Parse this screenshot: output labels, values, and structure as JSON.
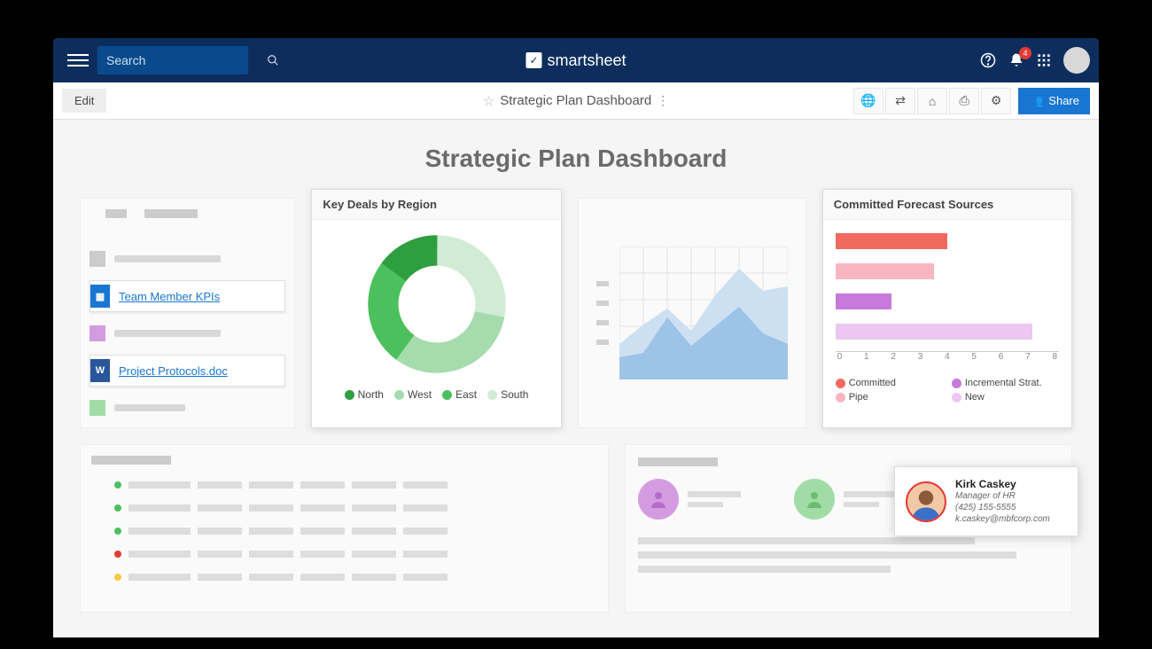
{
  "topbar": {
    "search_placeholder": "Search",
    "brand": "smartsheet",
    "notification_count": "4"
  },
  "subbar": {
    "edit_label": "Edit",
    "title": "Strategic Plan Dashboard",
    "share_label": "Share"
  },
  "page_title": "Strategic Plan Dashboard",
  "links_widget": {
    "link1": "Team Member KPIs",
    "link2": "Project Protocols.doc"
  },
  "donut_widget": {
    "title": "Key Deals by Region",
    "legend": {
      "north": "North",
      "west": "West",
      "east": "East",
      "south": "South"
    }
  },
  "bar_widget": {
    "title": "Committed Forecast Sources",
    "legend": {
      "committed": "Committed",
      "incremental": "Incremental Strat.",
      "pipe": "Pipe",
      "new": "New"
    },
    "ticks": [
      "0",
      "1",
      "2",
      "3",
      "4",
      "5",
      "6",
      "7",
      "8"
    ]
  },
  "contact": {
    "name": "Kirk Caskey",
    "role": "Manager of HR",
    "phone": "(425) 155-5555",
    "email": "k.caskey@mbfcorp.com"
  },
  "chart_data": [
    {
      "type": "pie",
      "title": "Key Deals by Region",
      "categories": [
        "North",
        "West",
        "East",
        "South"
      ],
      "values": [
        15,
        32,
        25,
        28
      ],
      "colors": [
        "#2e9e3f",
        "#a6dbae",
        "#4cc05d",
        "#d2ebd4"
      ]
    },
    {
      "type": "bar",
      "orientation": "horizontal",
      "title": "Committed Forecast Sources",
      "categories": [
        "Committed",
        "Pipe",
        "Incremental Strat.",
        "New"
      ],
      "values": [
        4.0,
        3.5,
        2.0,
        7.0
      ],
      "colors": [
        "#f16a5e",
        "#f7b6c0",
        "#c77ad9",
        "#edc6f2"
      ],
      "xlabel": "",
      "ylabel": "",
      "xlim": [
        0,
        8
      ]
    },
    {
      "type": "area",
      "note": "placeholder area chart, two stacked series, no labeled axes",
      "series": [
        {
          "name": "back",
          "values": [
            40,
            60,
            80,
            55,
            90,
            120,
            95,
            100
          ]
        },
        {
          "name": "front",
          "values": [
            25,
            30,
            65,
            35,
            55,
            75,
            50,
            40
          ]
        }
      ],
      "x": [
        1,
        2,
        3,
        4,
        5,
        6,
        7,
        8
      ],
      "ylim": [
        0,
        140
      ]
    }
  ]
}
